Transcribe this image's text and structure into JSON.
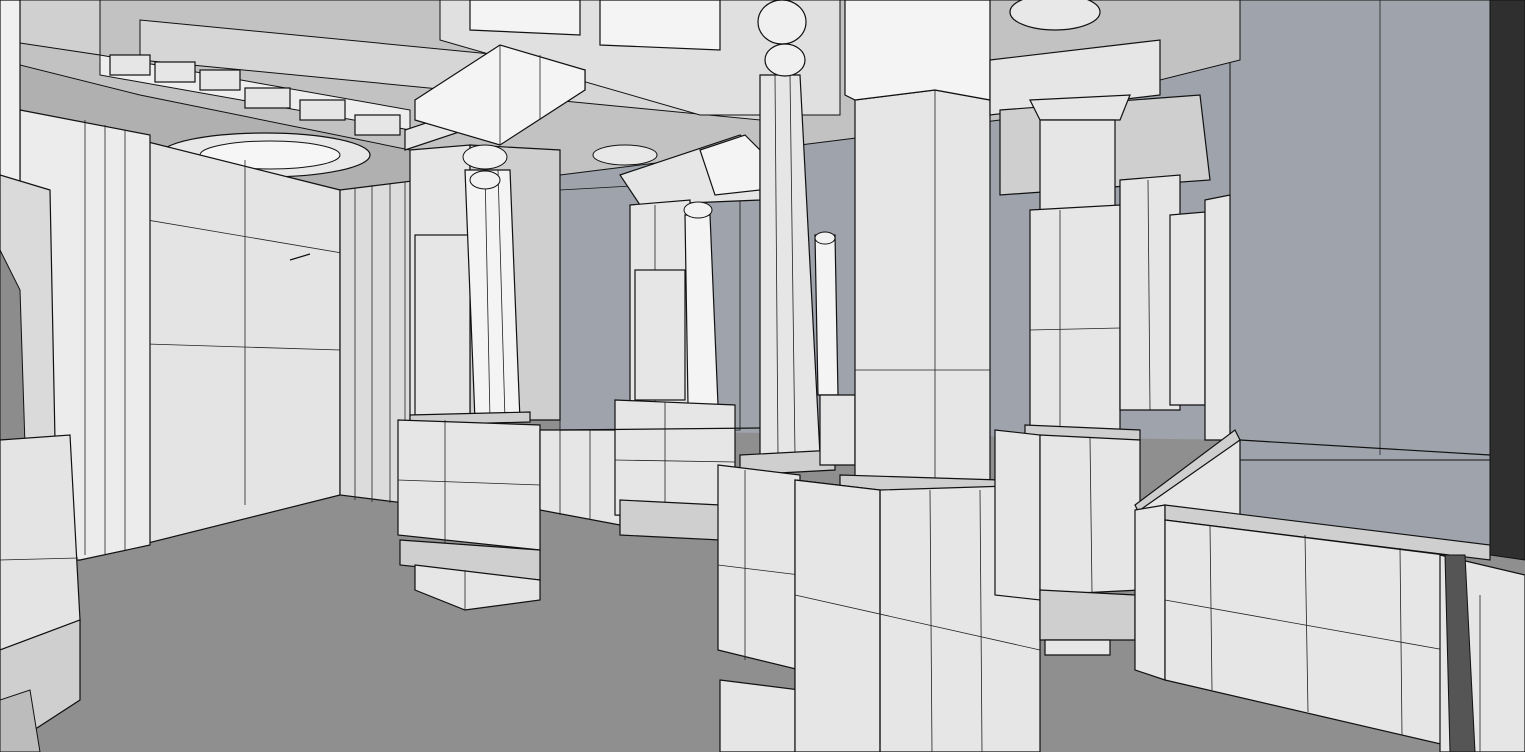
{
  "viewport": {
    "colors": {
      "floor": "#8f8f8f",
      "sky": "#9ea3ac",
      "ceiling": "#bcbcbc",
      "surface_light": "#e6e6e6",
      "surface_mid": "#cfcfcf",
      "surface_dark": "#a9a9a9",
      "edge": "#111111"
    }
  }
}
